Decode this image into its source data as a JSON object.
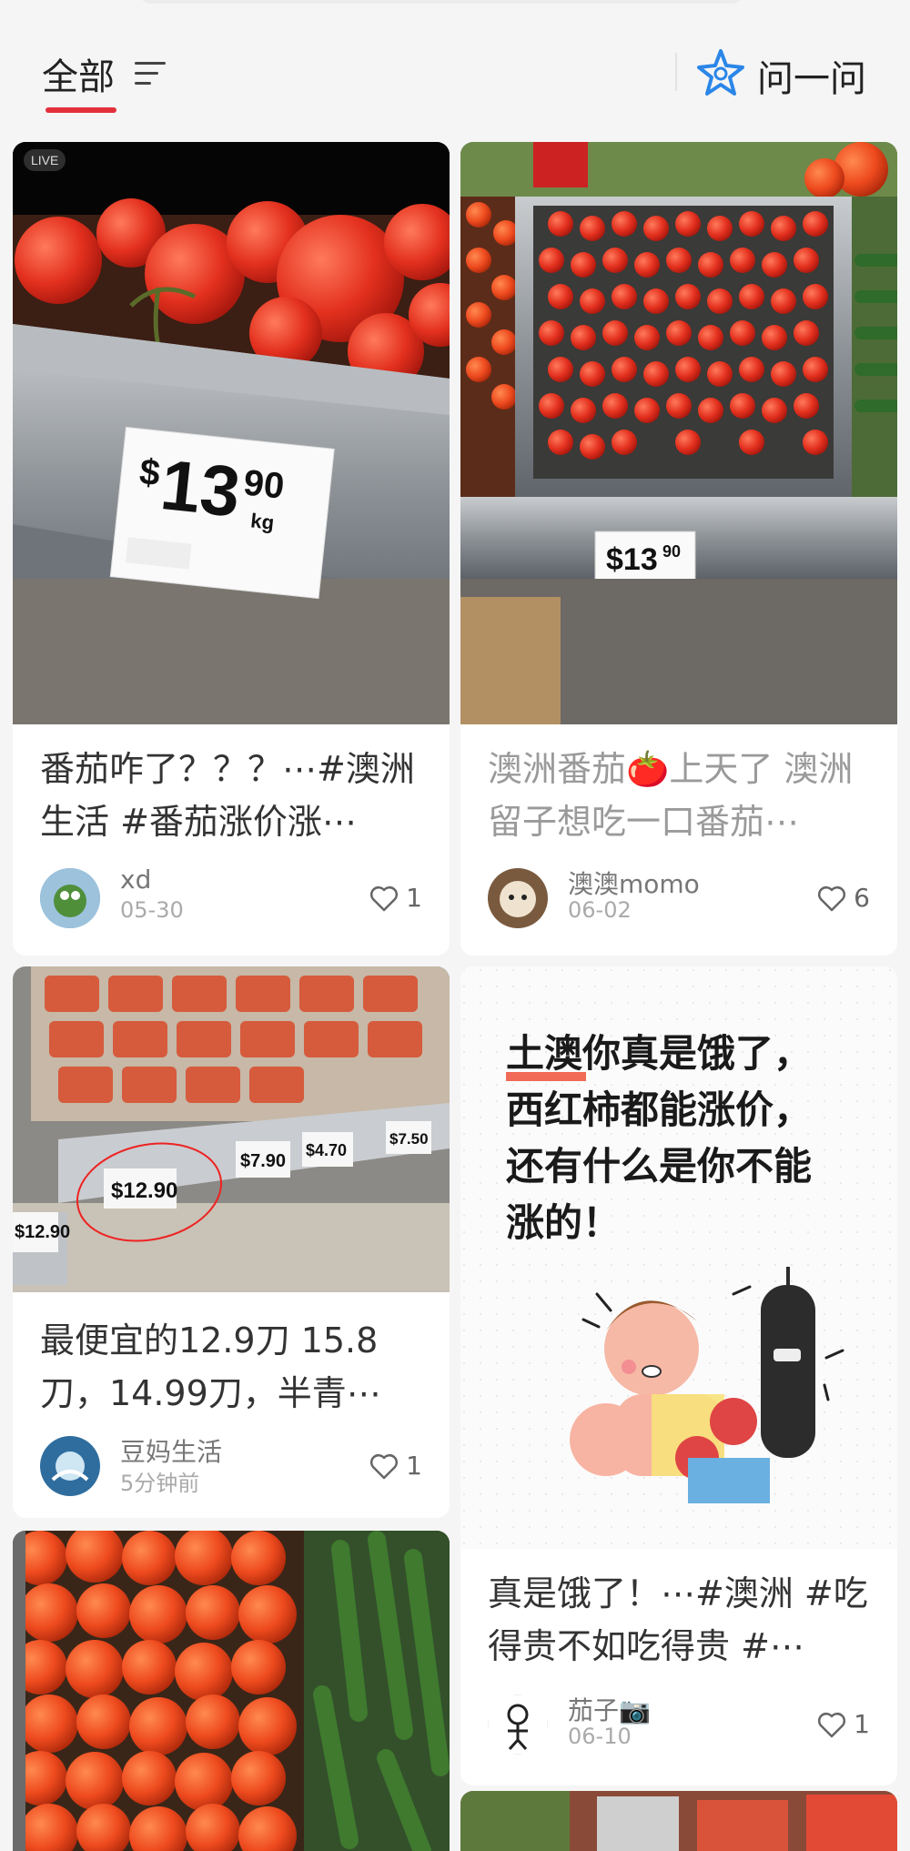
{
  "header": {
    "tab_all": "全部",
    "ask_label": "问一问"
  },
  "accent_color": "#e3303d",
  "icons": [
    "filter-icon",
    "ask-star-icon",
    "heart-icon",
    "live-icon",
    "tomato-emoji",
    "camera-emoji"
  ],
  "feed": [
    {
      "live_badge": "LIVE",
      "price_tag": "$13.90 kg",
      "title": "番茄咋了？？？⋯#澳洲生活 #番茄涨价涨⋯",
      "author": "xd",
      "date": "05-30",
      "likes": "1"
    },
    {
      "price_tag": "$13.90 kg",
      "title": "澳洲番茄🍅上天了 澳洲留子想吃一口番茄⋯",
      "author": "澳澳momo",
      "date": "06-02",
      "likes": "6"
    },
    {
      "price_tags": [
        "$12.90",
        "$7.90",
        "$4.70",
        "$7.50"
      ],
      "title": "最便宜的12.9刀 15.8刀，14.99刀，半青⋯",
      "author": "豆妈生活",
      "date": "5分钟前",
      "likes": "1"
    },
    {
      "illustration_text": [
        "土澳你真是饿了，",
        "西红柿都能涨价，",
        "还有什么是你不能",
        "涨的！"
      ],
      "title": "真是饿了！⋯#澳洲 #吃得贵不如吃得贵 #⋯",
      "author": "茄子📷",
      "date": "06-10",
      "likes": "1"
    }
  ]
}
